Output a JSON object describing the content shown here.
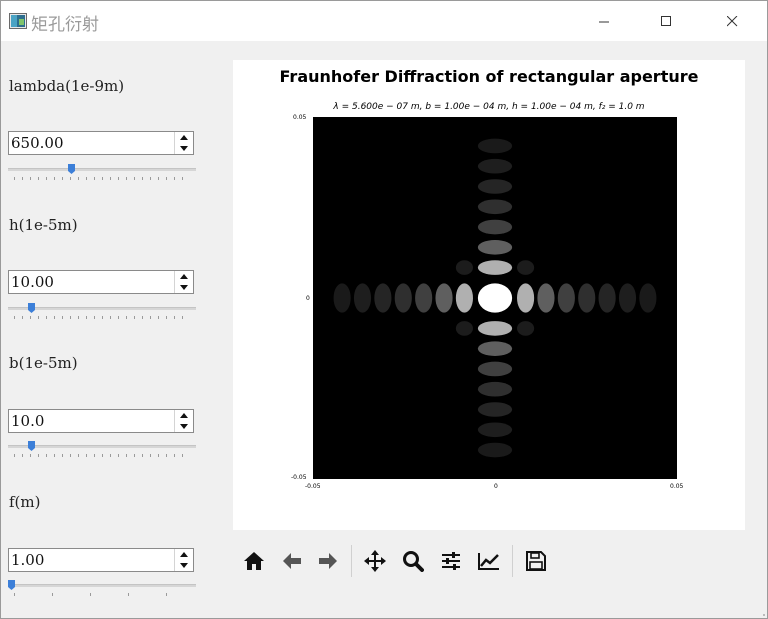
{
  "window": {
    "title": "矩孔衍射"
  },
  "params": [
    {
      "label": "lambda(1e-9m)",
      "value": "650.00",
      "slider_fraction": 0.33,
      "ticks": "dense"
    },
    {
      "label": "h(1e-5m)",
      "value": "10.00",
      "slider_fraction": 0.11,
      "ticks": "dense"
    },
    {
      "label": "b(1e-5m)",
      "value": "10.0",
      "slider_fraction": 0.11,
      "ticks": "dense"
    },
    {
      "label": "f(m)",
      "value": "1.00",
      "slider_fraction": 0.0,
      "ticks": "sparse"
    }
  ],
  "figure": {
    "title": "Fraunhofer Diffraction of rectangular aperture",
    "subtitle": "λ = 5.600e − 07 m,  b = 1.00e − 04 m,  h = 1.00e − 04 m,  f₂ = 1.0 m",
    "x_ticks": [
      "-0.05",
      "0",
      "0.05"
    ],
    "y_ticks": [
      "0.05",
      "0",
      "-0.05"
    ],
    "colormap": "gray"
  },
  "chart_data": {
    "type": "heatmap",
    "title": "Fraunhofer Diffraction of rectangular aperture",
    "x_range": [
      -0.05,
      0.05
    ],
    "y_range": [
      -0.05,
      0.05
    ],
    "lambda_m": 5.6e-07,
    "b_m": 0.0001,
    "h_m": 0.0001,
    "f_m": 1.0,
    "colormap": "gray"
  },
  "toolbar": [
    "home-icon",
    "back-icon",
    "forward-icon",
    "pan-icon",
    "zoom-icon",
    "configure-subplots-icon",
    "edit-axis-icon",
    "save-icon"
  ]
}
